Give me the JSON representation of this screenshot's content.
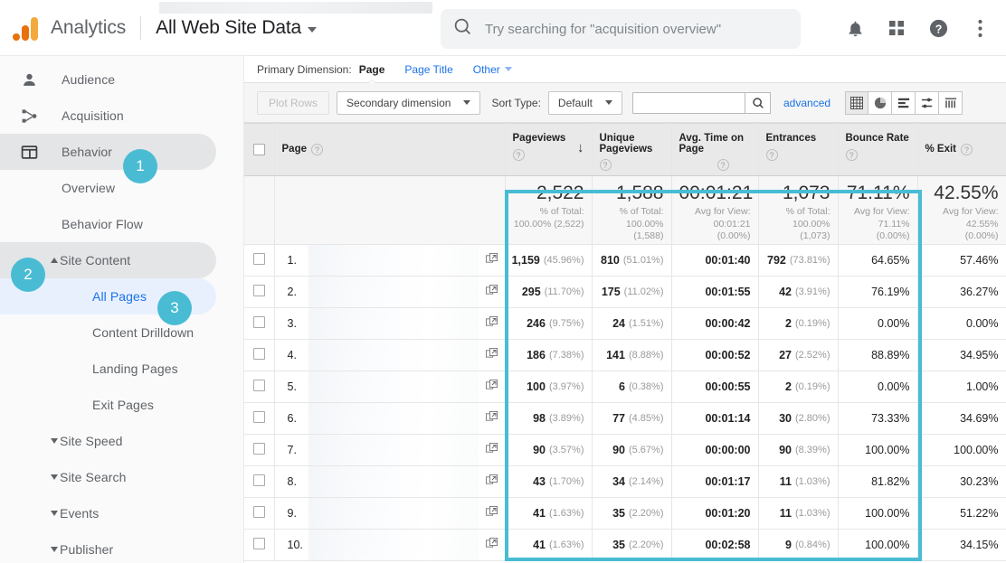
{
  "header": {
    "brand": "Analytics",
    "view_name": "All Web Site Data",
    "redacted_property_bar": "",
    "search_placeholder": "Try searching for \"acquisition overview\"",
    "icons": [
      "search-icon",
      "bell-icon",
      "apps-grid-icon",
      "help-icon",
      "more-vert-icon"
    ]
  },
  "sidebar": {
    "top_items": [
      {
        "label": "Audience",
        "icon": "person-icon",
        "active": false
      },
      {
        "label": "Acquisition",
        "icon": "share-nodes-icon",
        "active": false
      },
      {
        "label": "Behavior",
        "icon": "layout-icon",
        "active": true,
        "badge": "1"
      }
    ],
    "behavior_children": [
      {
        "label": "Overview",
        "type": "leaf",
        "current": false
      },
      {
        "label": "Behavior Flow",
        "type": "leaf",
        "current": false
      },
      {
        "label": "Site Content",
        "type": "group",
        "expanded": true,
        "selected": true,
        "badge": "2"
      },
      {
        "label": "All Pages",
        "type": "leaf",
        "current": true,
        "badge": "3"
      },
      {
        "label": "Content Drilldown",
        "type": "leaf",
        "current": false
      },
      {
        "label": "Landing Pages",
        "type": "leaf",
        "current": false
      },
      {
        "label": "Exit Pages",
        "type": "leaf",
        "current": false
      },
      {
        "label": "Site Speed",
        "type": "group",
        "expanded": false
      },
      {
        "label": "Site Search",
        "type": "group",
        "expanded": false
      },
      {
        "label": "Events",
        "type": "group",
        "expanded": false
      },
      {
        "label": "Publisher",
        "type": "group",
        "expanded": false
      }
    ]
  },
  "primary_dimension": {
    "label": "Primary Dimension:",
    "selected": "Page",
    "options": [
      "Page Title",
      "Other"
    ]
  },
  "toolbar": {
    "plot_rows": "Plot Rows",
    "secondary_dimension": "Secondary dimension",
    "sort_type_label": "Sort Type:",
    "sort_type_value": "Default",
    "search_value": "",
    "advanced": "advanced",
    "view_buttons": [
      "table-view-icon",
      "pie-view-icon",
      "bar-view-icon",
      "comparison-view-icon",
      "pivot-view-icon"
    ],
    "view_active_index": 0
  },
  "table": {
    "columns": [
      {
        "key": "page",
        "label": "Page",
        "help": "?"
      },
      {
        "key": "pageviews",
        "label": "Pageviews",
        "help": "?",
        "sorted": "desc"
      },
      {
        "key": "unique_pageviews",
        "label": "Unique Pageviews",
        "help": "?"
      },
      {
        "key": "avg_time",
        "label": "Avg. Time on Page",
        "help": "?"
      },
      {
        "key": "entrances",
        "label": "Entrances",
        "help": "?"
      },
      {
        "key": "bounce_rate",
        "label": "Bounce Rate",
        "help": "?"
      },
      {
        "key": "exit_pct",
        "label": "% Exit",
        "help": "?"
      }
    ],
    "totals": {
      "pageviews": {
        "value": "2,522",
        "sub1": "% of Total:",
        "sub2": "100.00% (2,522)"
      },
      "unique_pageviews": {
        "value": "1,588",
        "sub1": "% of Total:",
        "sub2": "100.00%",
        "sub3": "(1,588)"
      },
      "avg_time": {
        "value": "00:01:21",
        "sub1": "Avg for View:",
        "sub2": "00:01:21",
        "sub3": "(0.00%)"
      },
      "entrances": {
        "value": "1,073",
        "sub1": "% of Total:",
        "sub2": "100.00%",
        "sub3": "(1,073)"
      },
      "bounce_rate": {
        "value": "71.11%",
        "sub1": "Avg for View:",
        "sub2": "71.11%",
        "sub3": "(0.00%)"
      },
      "exit_pct": {
        "value": "42.55%",
        "sub1": "Avg for View:",
        "sub2": "42.55%",
        "sub3": "(0.00%)"
      }
    },
    "rows": [
      {
        "index": "1.",
        "page": "",
        "pageviews": "1,159",
        "pageviews_pct": "(45.96%)",
        "unique": "810",
        "unique_pct": "(51.01%)",
        "avg_time": "00:01:40",
        "entrances": "792",
        "entrances_pct": "(73.81%)",
        "bounce": "64.65%",
        "exit": "57.46%"
      },
      {
        "index": "2.",
        "page": "",
        "pageviews": "295",
        "pageviews_pct": "(11.70%)",
        "unique": "175",
        "unique_pct": "(11.02%)",
        "avg_time": "00:01:55",
        "entrances": "42",
        "entrances_pct": "(3.91%)",
        "bounce": "76.19%",
        "exit": "36.27%"
      },
      {
        "index": "3.",
        "page": "",
        "pageviews": "246",
        "pageviews_pct": "(9.75%)",
        "unique": "24",
        "unique_pct": "(1.51%)",
        "avg_time": "00:00:42",
        "entrances": "2",
        "entrances_pct": "(0.19%)",
        "bounce": "0.00%",
        "exit": "0.00%"
      },
      {
        "index": "4.",
        "page": "",
        "pageviews": "186",
        "pageviews_pct": "(7.38%)",
        "unique": "141",
        "unique_pct": "(8.88%)",
        "avg_time": "00:00:52",
        "entrances": "27",
        "entrances_pct": "(2.52%)",
        "bounce": "88.89%",
        "exit": "34.95%"
      },
      {
        "index": "5.",
        "page": "",
        "pageviews": "100",
        "pageviews_pct": "(3.97%)",
        "unique": "6",
        "unique_pct": "(0.38%)",
        "avg_time": "00:00:55",
        "entrances": "2",
        "entrances_pct": "(0.19%)",
        "bounce": "0.00%",
        "exit": "1.00%"
      },
      {
        "index": "6.",
        "page": "",
        "pageviews": "98",
        "pageviews_pct": "(3.89%)",
        "unique": "77",
        "unique_pct": "(4.85%)",
        "avg_time": "00:01:14",
        "entrances": "30",
        "entrances_pct": "(2.80%)",
        "bounce": "73.33%",
        "exit": "34.69%"
      },
      {
        "index": "7.",
        "page": "",
        "pageviews": "90",
        "pageviews_pct": "(3.57%)",
        "unique": "90",
        "unique_pct": "(5.67%)",
        "avg_time": "00:00:00",
        "entrances": "90",
        "entrances_pct": "(8.39%)",
        "bounce": "100.00%",
        "exit": "100.00%"
      },
      {
        "index": "8.",
        "page": "",
        "pageviews": "43",
        "pageviews_pct": "(1.70%)",
        "unique": "34",
        "unique_pct": "(2.14%)",
        "avg_time": "00:01:17",
        "entrances": "11",
        "entrances_pct": "(1.03%)",
        "bounce": "81.82%",
        "exit": "30.23%"
      },
      {
        "index": "9.",
        "page": "",
        "pageviews": "41",
        "pageviews_pct": "(1.63%)",
        "unique": "35",
        "unique_pct": "(2.20%)",
        "avg_time": "00:01:20",
        "entrances": "11",
        "entrances_pct": "(1.03%)",
        "bounce": "100.00%",
        "exit": "51.22%"
      },
      {
        "index": "10.",
        "page": "",
        "pageviews": "41",
        "pageviews_pct": "(1.63%)",
        "unique": "35",
        "unique_pct": "(2.20%)",
        "avg_time": "00:02:58",
        "entrances": "9",
        "entrances_pct": "(0.84%)",
        "bounce": "100.00%",
        "exit": "34.15%"
      }
    ]
  },
  "annotations": {
    "badge_color": "#49bcd4",
    "highlight_color": "#49bcd4",
    "steps": [
      "1",
      "2",
      "3"
    ]
  },
  "colors": {
    "accent_blue": "#1a73e8",
    "logo_orange_dark": "#E8710A",
    "logo_orange_light": "#F4A93C",
    "cyan": "#49bcd4"
  }
}
